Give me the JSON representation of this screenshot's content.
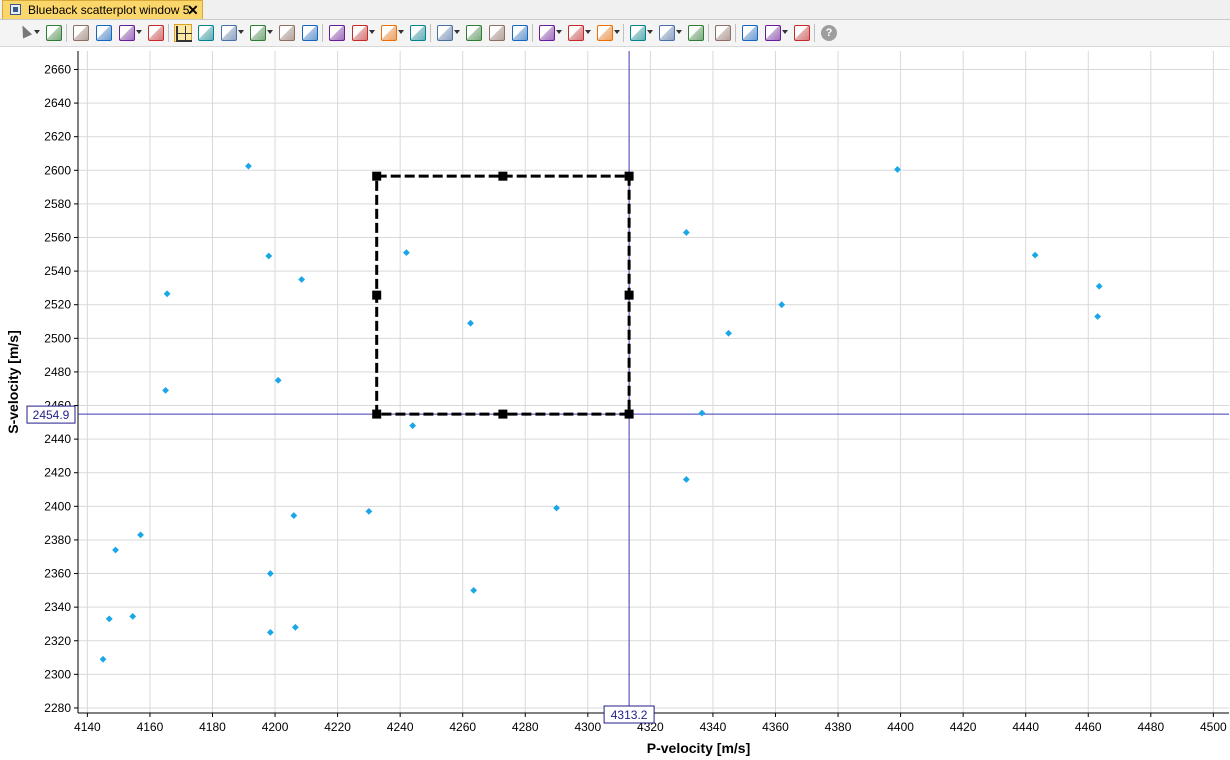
{
  "window": {
    "tab_title": "Blueback scatterplot window 5",
    "close_glyph": "✕"
  },
  "toolbar": {
    "buttons": [
      {
        "name": "select-tool-icon",
        "dropdown": true
      },
      {
        "name": "view-eye-icon",
        "dropdown": false
      },
      {
        "name": "copy-window-icon",
        "dropdown": false
      },
      {
        "name": "export-window-icon",
        "dropdown": false
      },
      {
        "name": "layers-icon",
        "dropdown": true
      },
      {
        "name": "tools-icon",
        "dropdown": false
      },
      {
        "name": "crosshair-icon",
        "dropdown": false,
        "active": true
      },
      {
        "name": "color-table-icon",
        "dropdown": false
      },
      {
        "name": "frame-icon",
        "dropdown": true
      },
      {
        "name": "border-icon",
        "dropdown": true
      },
      {
        "name": "rotate-icon",
        "dropdown": false
      },
      {
        "name": "link-icon",
        "dropdown": false
      },
      {
        "name": "regression-icon",
        "dropdown": false
      },
      {
        "name": "grid-icon",
        "dropdown": true
      },
      {
        "name": "dots-grid-icon",
        "dropdown": true
      },
      {
        "name": "bar-icon",
        "dropdown": false
      },
      {
        "name": "globe-icon",
        "dropdown": true
      },
      {
        "name": "stack-icon",
        "dropdown": false
      },
      {
        "name": "column-icon",
        "dropdown": false
      },
      {
        "name": "chart-icon",
        "dropdown": false
      },
      {
        "name": "star-box-icon",
        "dropdown": true
      },
      {
        "name": "window-box-icon",
        "dropdown": true
      },
      {
        "name": "filter-box-icon",
        "dropdown": true
      },
      {
        "name": "new-polygon-icon",
        "dropdown": true
      },
      {
        "name": "edit-polygon-icon",
        "dropdown": true
      },
      {
        "name": "delete-polygon-icon",
        "dropdown": false
      },
      {
        "name": "axis-icon",
        "dropdown": false
      },
      {
        "name": "new-table-icon",
        "dropdown": false
      },
      {
        "name": "table-options-icon",
        "dropdown": true
      },
      {
        "name": "table-grid-icon",
        "dropdown": false
      },
      {
        "name": "help-icon",
        "dropdown": false
      }
    ]
  },
  "chart_data": {
    "type": "scatter",
    "xlabel": "P-velocity [m/s]",
    "ylabel": "S-velocity [m/s]",
    "xlim": [
      4137,
      4505
    ],
    "ylim": [
      2277,
      2671
    ],
    "xticks": [
      4140,
      4160,
      4180,
      4200,
      4220,
      4240,
      4260,
      4280,
      4300,
      4320,
      4340,
      4360,
      4380,
      4400,
      4420,
      4440,
      4460,
      4480,
      4500
    ],
    "yticks": [
      2280,
      2300,
      2320,
      2340,
      2360,
      2380,
      2400,
      2420,
      2440,
      2460,
      2480,
      2500,
      2520,
      2540,
      2560,
      2580,
      2600,
      2620,
      2640,
      2660
    ],
    "grid": true,
    "point_color": "#1aa7e8",
    "points": [
      {
        "x": 4191.5,
        "y": 2602.5
      },
      {
        "x": 4198,
        "y": 2549
      },
      {
        "x": 4208.5,
        "y": 2535
      },
      {
        "x": 4165.5,
        "y": 2526.5
      },
      {
        "x": 4165,
        "y": 2469
      },
      {
        "x": 4201,
        "y": 2475
      },
      {
        "x": 4242,
        "y": 2551
      },
      {
        "x": 4262.5,
        "y": 2509
      },
      {
        "x": 4244,
        "y": 2448
      },
      {
        "x": 4230,
        "y": 2397
      },
      {
        "x": 4206,
        "y": 2394.5
      },
      {
        "x": 4157,
        "y": 2383
      },
      {
        "x": 4149,
        "y": 2374
      },
      {
        "x": 4198.5,
        "y": 2360
      },
      {
        "x": 4263.5,
        "y": 2350
      },
      {
        "x": 4147,
        "y": 2333
      },
      {
        "x": 4154.5,
        "y": 2334.5
      },
      {
        "x": 4206.5,
        "y": 2328
      },
      {
        "x": 4198.5,
        "y": 2325
      },
      {
        "x": 4145,
        "y": 2309
      },
      {
        "x": 4290,
        "y": 2399
      },
      {
        "x": 4331.5,
        "y": 2563
      },
      {
        "x": 4345,
        "y": 2503
      },
      {
        "x": 4336.5,
        "y": 2455.5
      },
      {
        "x": 4331.5,
        "y": 2416
      },
      {
        "x": 4362,
        "y": 2520
      },
      {
        "x": 4399,
        "y": 2600.5
      },
      {
        "x": 4443,
        "y": 2549.5
      },
      {
        "x": 4463.5,
        "y": 2531
      },
      {
        "x": 4463,
        "y": 2513
      }
    ],
    "selection_polygon": {
      "x_min": 4232.5,
      "x_max": 4313.2,
      "y_min": 2454.9,
      "y_max": 2596.5
    },
    "cursor": {
      "x": 4313.2,
      "y": 2454.9,
      "x_label": "4313.2",
      "y_label": "2454.9"
    }
  }
}
